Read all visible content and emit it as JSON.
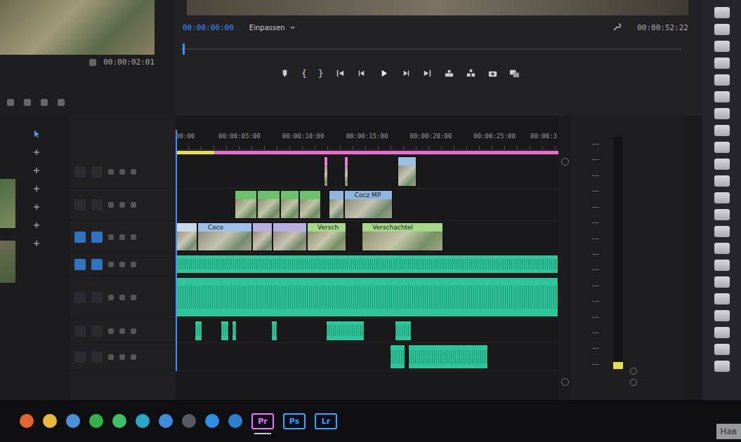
{
  "source_monitor": {
    "timecode": "00:00:02:01"
  },
  "program_monitor": {
    "timecode": "00:00:00:00",
    "zoom": "Einpassen",
    "duration": "00:00:52:22",
    "transport": [
      {
        "kind": "marker"
      },
      {
        "kind": "glyph",
        "label": "{"
      },
      {
        "kind": "glyph",
        "label": "}"
      },
      {
        "kind": "go-in"
      },
      {
        "kind": "step-back"
      },
      {
        "kind": "play"
      },
      {
        "kind": "step-forward"
      },
      {
        "kind": "go-out"
      },
      {
        "kind": "lift"
      },
      {
        "kind": "extract"
      },
      {
        "kind": "camera"
      },
      {
        "kind": "compare"
      }
    ]
  },
  "timeline": {
    "duration": 30,
    "playhead": 0,
    "render_bar": [
      {
        "start": 0,
        "end": 3,
        "color": "#e4df4c"
      },
      {
        "start": 3,
        "end": 30,
        "color": "#e66fd0"
      }
    ],
    "ruler": [
      {
        "label": "00:00",
        "time": 0
      },
      {
        "label": "00:00:05:00",
        "time": 5
      },
      {
        "label": "00:00:10:00",
        "time": 10
      },
      {
        "label": "00:00:15:00",
        "time": 15
      },
      {
        "label": "00:00:20:00",
        "time": 20
      },
      {
        "label": "00:00:25:00",
        "time": 25
      },
      {
        "label": "00:00:3",
        "time": 30
      }
    ],
    "tracks": [
      {
        "kind": "video",
        "targeted": false,
        "clips": [
          {
            "start": 11.6,
            "end": 11.95,
            "color": "#e87bd6"
          },
          {
            "start": 13.2,
            "end": 13.55,
            "color": "#e87bd6"
          },
          {
            "start": 17.4,
            "end": 18.9,
            "color": "#9cc0e0"
          }
        ]
      },
      {
        "kind": "video",
        "targeted": false,
        "clips": [
          {
            "start": 4.6,
            "end": 6.4,
            "color": "#6cc26c"
          },
          {
            "start": 6.4,
            "end": 8.2,
            "color": "#6cc26c"
          },
          {
            "start": 8.2,
            "end": 9.7,
            "color": "#6cc26c"
          },
          {
            "start": 9.7,
            "end": 11.4,
            "color": "#6cc26c"
          },
          {
            "start": 12.0,
            "end": 13.2,
            "color": "#8fb6e0"
          },
          {
            "start": 13.2,
            "end": 17.0,
            "color": "#8fb6e0",
            "label": "Cocz MP"
          }
        ]
      },
      {
        "kind": "video",
        "targeted": true,
        "clips": [
          {
            "start": 0,
            "end": 1.7,
            "color": "#c9d9ea"
          },
          {
            "start": 1.7,
            "end": 6.0,
            "color": "#9fc0e6",
            "label": "Coco"
          },
          {
            "start": 6.0,
            "end": 7.6,
            "color": "#b9aee0"
          },
          {
            "start": 7.6,
            "end": 10.3,
            "color": "#b9aee0"
          },
          {
            "start": 10.3,
            "end": 13.4,
            "color": "#a6d88a",
            "label": "Versch"
          },
          {
            "start": 14.6,
            "end": 21.0,
            "color": "#a6d88a",
            "label": "Verschachtel"
          }
        ]
      },
      {
        "kind": "audio",
        "targeted": true,
        "clips": [
          {
            "start": 0,
            "end": 30,
            "color": "#2fc59b"
          }
        ]
      },
      {
        "kind": "audio",
        "targeted": false,
        "clips": [
          {
            "start": 0,
            "end": 30,
            "color": "#2fc59b"
          }
        ]
      },
      {
        "kind": "audio",
        "targeted": false,
        "clips": [
          {
            "start": 1.5,
            "end": 2.1,
            "color": "#2fc59b"
          },
          {
            "start": 3.5,
            "end": 4.2,
            "color": "#2fc59b"
          },
          {
            "start": 4.4,
            "end": 4.8,
            "color": "#2fc59b"
          },
          {
            "start": 7.5,
            "end": 8.0,
            "color": "#2fc59b"
          },
          {
            "start": 11.8,
            "end": 14.8,
            "color": "#2fc59b"
          },
          {
            "start": 17.2,
            "end": 18.5,
            "color": "#2fc59b"
          }
        ]
      },
      {
        "kind": "audio",
        "targeted": false,
        "clips": [
          {
            "start": 16.8,
            "end": 18.0,
            "color": "#2fc59b"
          },
          {
            "start": 18.2,
            "end": 24.5,
            "color": "#2fc59b"
          }
        ]
      }
    ]
  },
  "audio_meter": {
    "level": 0.03
  },
  "taskbar": {
    "pinned": [
      {
        "color": "#e0672e"
      },
      {
        "color": "#e8b93a"
      },
      {
        "color": "#4a90d9"
      },
      {
        "color": "#2fb34a"
      },
      {
        "color": "#3fbf6a"
      },
      {
        "color": "#2aa6c8"
      },
      {
        "color": "#3c8de0"
      },
      {
        "color": "#555a63"
      },
      {
        "color": "#2d8fe6"
      },
      {
        "color": "#2d7fd0"
      }
    ],
    "apps": [
      {
        "label": "Pr",
        "selected": true,
        "color": "#ea77ff"
      },
      {
        "label": "Ps",
        "selected": false,
        "color": "#31a8ff"
      },
      {
        "label": "Lr",
        "selected": false,
        "color": "#31a8ff"
      }
    ]
  },
  "watermark": "Нав"
}
